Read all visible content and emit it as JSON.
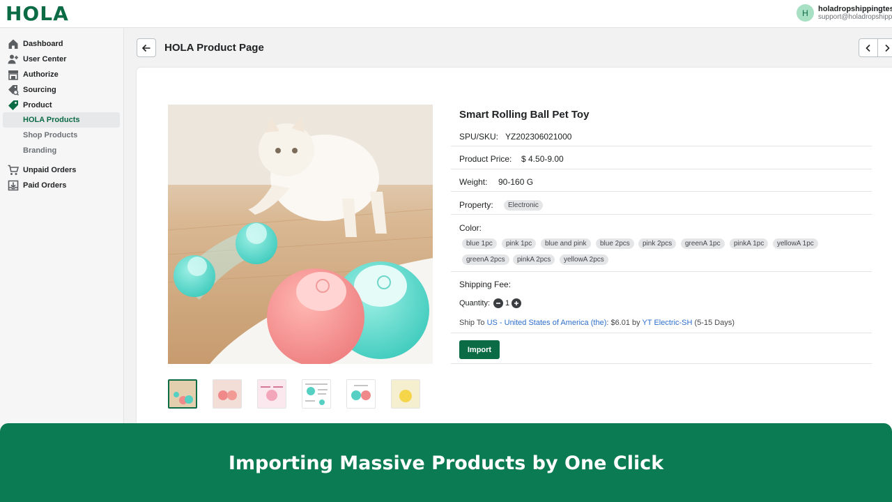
{
  "app": {
    "logo_text": "HOLA"
  },
  "user": {
    "initial": "H",
    "name": "holadropshippingtest",
    "email": "support@holadropshipping"
  },
  "sidebar": {
    "items": [
      {
        "label": "Dashboard",
        "icon": "home-icon"
      },
      {
        "label": "User Center",
        "icon": "user-add-icon"
      },
      {
        "label": "Authorize",
        "icon": "store-icon"
      },
      {
        "label": "Sourcing",
        "icon": "search-tag-icon"
      },
      {
        "label": "Product",
        "icon": "tag-icon"
      },
      {
        "label": "Unpaid Orders",
        "icon": "cart-icon"
      },
      {
        "label": "Paid Orders",
        "icon": "download-box-icon"
      }
    ],
    "sub_items": [
      {
        "label": "HOLA Products",
        "active": true
      },
      {
        "label": "Shop Products",
        "active": false
      },
      {
        "label": "Branding",
        "active": false
      }
    ]
  },
  "page": {
    "title": "HOLA Product Page"
  },
  "product": {
    "title": "Smart Rolling Ball Pet Toy",
    "sku_label": "SPU/SKU:",
    "sku": "YZ202306021000",
    "price_label": "Product Price:",
    "price": "$ 4.50-9.00",
    "weight_label": "Weight:",
    "weight": "90-160 G",
    "property_label": "Property:",
    "property": "Electronic",
    "color_label": "Color:",
    "colors": [
      "blue 1pc",
      "pink 1pc",
      "blue and pink",
      "blue 2pcs",
      "pink 2pcs",
      "greenA 1pc",
      "pinkA 1pc",
      "yellowA 1pc",
      "greenA 2pcs",
      "pinkA 2pcs",
      "yellowA 2pcs"
    ],
    "shipping_label": "Shipping Fee:",
    "quantity_label": "Quantity:",
    "quantity": "1",
    "ship_to_prefix": "Ship To",
    "ship_country": "US - United States of America (the)",
    "ship_price": ": $6.01 by",
    "ship_carrier": "YT Electric-SH",
    "ship_days": "(5-15 Days)",
    "import_label": "Import"
  },
  "banner": {
    "text": "Importing Massive Products by One Click"
  },
  "colors": {
    "brand": "#0b6b45",
    "banner": "#0b7b53",
    "link": "#2c6ecb"
  }
}
